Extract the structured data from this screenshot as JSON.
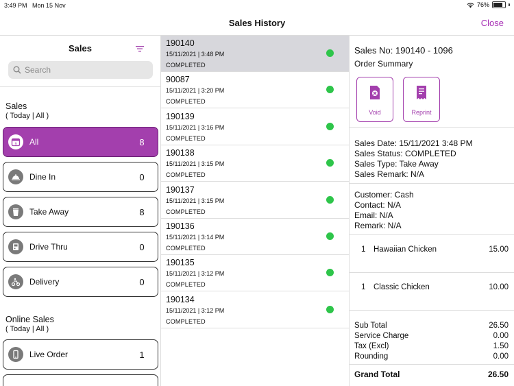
{
  "status_bar": {
    "time": "3:49 PM",
    "date": "Mon 15 Nov",
    "battery": "76%"
  },
  "nav": {
    "title": "Sales History",
    "close_label": "Close"
  },
  "sidebar": {
    "title": "Sales",
    "search_placeholder": "Search",
    "sales_section": {
      "title": "Sales",
      "subtitle": "( Today | All )"
    },
    "categories": [
      {
        "label": "All",
        "count": "8",
        "icon": "calendar-icon"
      },
      {
        "label": "Dine In",
        "count": "0",
        "icon": "dine-in-icon"
      },
      {
        "label": "Take Away",
        "count": "8",
        "icon": "take-away-icon"
      },
      {
        "label": "Drive Thru",
        "count": "0",
        "icon": "drive-thru-icon"
      },
      {
        "label": "Delivery",
        "count": "0",
        "icon": "delivery-icon"
      }
    ],
    "online_section": {
      "title": "Online Sales",
      "subtitle": "( Today | All )"
    },
    "online_categories": [
      {
        "label": "Live Order",
        "count": "1",
        "icon": "phone-icon"
      }
    ]
  },
  "orders": [
    {
      "number": "190140",
      "datetime": "15/11/2021 | 3:48 PM",
      "status": "COMPLETED"
    },
    {
      "number": "90087",
      "datetime": "15/11/2021 | 3:20 PM",
      "status": "COMPLETED"
    },
    {
      "number": "190139",
      "datetime": "15/11/2021 | 3:16 PM",
      "status": "COMPLETED"
    },
    {
      "number": "190138",
      "datetime": "15/11/2021 | 3:15 PM",
      "status": "COMPLETED"
    },
    {
      "number": "190137",
      "datetime": "15/11/2021 | 3:15 PM",
      "status": "COMPLETED"
    },
    {
      "number": "190136",
      "datetime": "15/11/2021 | 3:14 PM",
      "status": "COMPLETED"
    },
    {
      "number": "190135",
      "datetime": "15/11/2021 | 3:12 PM",
      "status": "COMPLETED"
    },
    {
      "number": "190134",
      "datetime": "15/11/2021 | 3:12 PM",
      "status": "COMPLETED"
    }
  ],
  "detail": {
    "sales_no": "Sales No: 190140 - 1096",
    "subtitle": "Order Summary",
    "void_label": "Void",
    "reprint_label": "Reprint",
    "info": [
      "Sales Date: 15/11/2021 3:48 PM",
      "Sales Status: COMPLETED",
      "Sales Type: Take Away",
      "Sales Remark: N/A"
    ],
    "customer": [
      "Customer: Cash",
      "Contact: N/A",
      "Email: N/A",
      "Remark: N/A"
    ],
    "items": [
      {
        "qty": "1",
        "name": "Hawaiian Chicken",
        "price": "15.00"
      },
      {
        "qty": "1",
        "name": "Classic Chicken",
        "price": "10.00"
      }
    ],
    "totals": [
      {
        "label": "Sub Total",
        "value": "26.50"
      },
      {
        "label": "Service Charge",
        "value": "0.00"
      },
      {
        "label": "Tax (Excl)",
        "value": "1.50"
      },
      {
        "label": "Rounding",
        "value": "0.00"
      }
    ],
    "grand_total": {
      "label": "Grand Total",
      "value": "26.50"
    }
  },
  "colors": {
    "accent": "#a33fad",
    "status_ok": "#2ec54a"
  }
}
